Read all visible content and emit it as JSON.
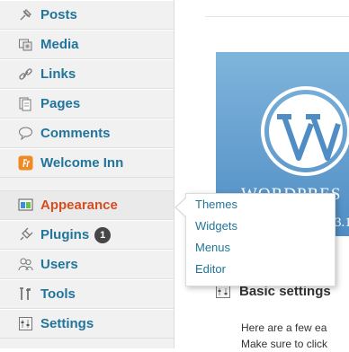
{
  "sidebar": {
    "items": [
      {
        "label": "Posts",
        "icon": "pushpin-icon"
      },
      {
        "label": "Media",
        "icon": "media-icon"
      },
      {
        "label": "Links",
        "icon": "links-icon"
      },
      {
        "label": "Pages",
        "icon": "pages-icon"
      },
      {
        "label": "Comments",
        "icon": "comments-icon"
      },
      {
        "label": "Welcome Inn",
        "icon": "welcome-inn-icon"
      },
      {
        "label": "Appearance",
        "icon": "appearance-icon",
        "active": true
      },
      {
        "label": "Plugins",
        "icon": "plugins-icon",
        "badge": "1"
      },
      {
        "label": "Users",
        "icon": "users-icon"
      },
      {
        "label": "Tools",
        "icon": "tools-icon"
      },
      {
        "label": "Settings",
        "icon": "settings-icon"
      }
    ]
  },
  "appearance_submenu": {
    "items": [
      {
        "label": "Themes"
      },
      {
        "label": "Widgets"
      },
      {
        "label": "Menus"
      },
      {
        "label": "Editor"
      }
    ]
  },
  "content": {
    "banner_word": "WORDPRES",
    "banner_version": "3.1",
    "heading": "Basic settings",
    "paragraph_lines": [
      "Here are a few ea",
      "Make sure to click"
    ]
  },
  "colors": {
    "link": "#21759b",
    "active": "#d54e21",
    "sidebar_bg": "#f1f1f1",
    "banner_top": "#7fb5dc",
    "banner_bottom": "#4f8dc4"
  }
}
